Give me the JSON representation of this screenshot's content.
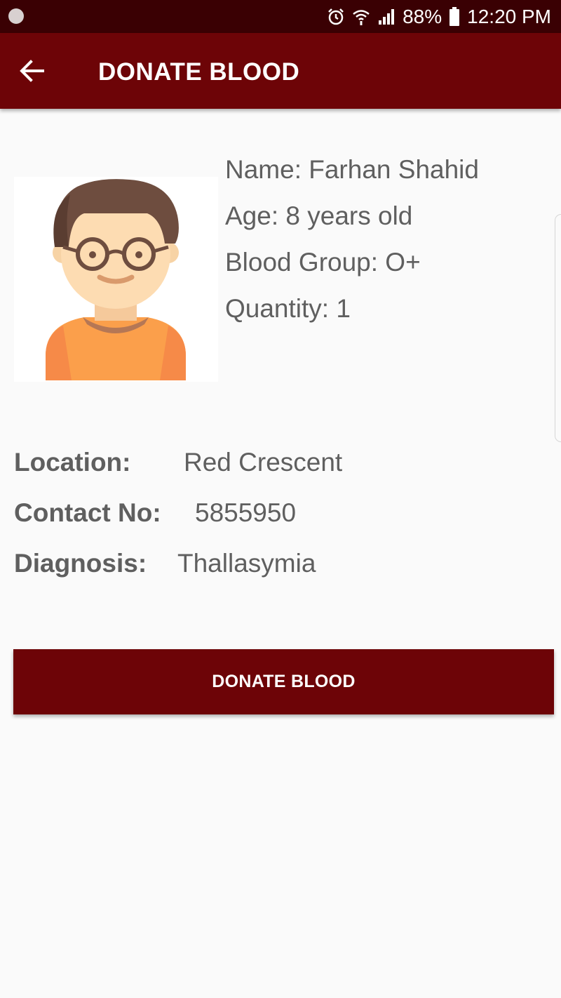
{
  "status_bar": {
    "battery": "88%",
    "time": "12:20 PM",
    "icons": [
      "notification-dot-icon",
      "alarm-icon",
      "wifi-icon",
      "signal-icon",
      "battery-icon"
    ]
  },
  "app_bar": {
    "title": "DONATE BLOOD",
    "back_icon": "arrow-left-icon"
  },
  "patient": {
    "name": "Name: Farhan Shahid",
    "age": "Age: 8 years old",
    "blood_group": "Blood Group: O+",
    "quantity": "Quantity: 1",
    "avatar_icon": "boy-with-glasses-avatar"
  },
  "details": {
    "location_label": "Location:",
    "location_value": "Red Crescent",
    "contact_label": "Contact No:",
    "contact_value": "5855950",
    "diagnosis_label": "Diagnosis:",
    "diagnosis_value": "Thallasymia"
  },
  "actions": {
    "donate_label": "DONATE BLOOD"
  },
  "colors": {
    "primary": "#6d0407",
    "status_bar": "#3a0003",
    "background": "#fafafa",
    "text": "#5f5f5f"
  }
}
